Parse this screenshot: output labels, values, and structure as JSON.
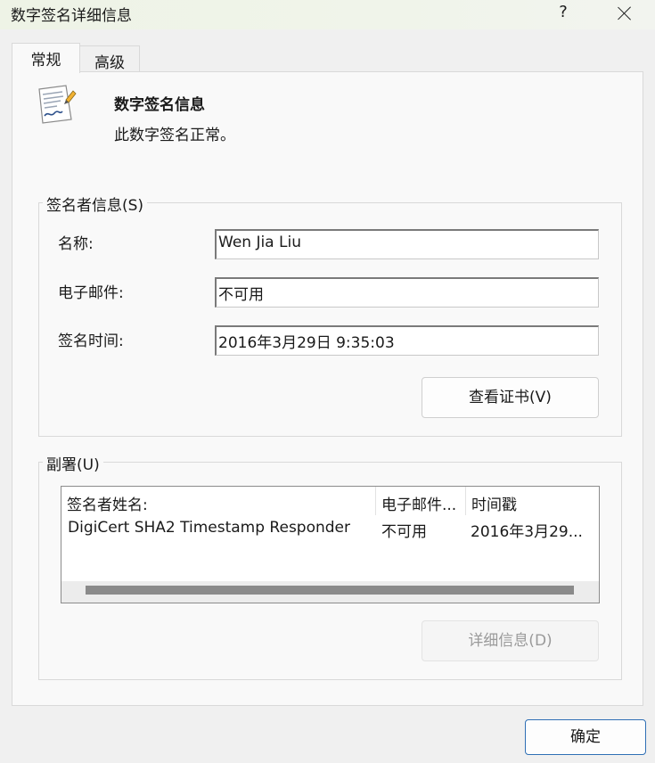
{
  "window": {
    "title": "数字签名详细信息",
    "help_label": "?"
  },
  "tabs": [
    {
      "label": "常规",
      "selected": true
    },
    {
      "label": "高级",
      "selected": false
    }
  ],
  "info": {
    "heading": "数字签名信息",
    "status": "此数字签名正常。"
  },
  "signer": {
    "legend": "签名者信息(S)",
    "name_label": "名称:",
    "name_value": "Wen Jia Liu",
    "email_label": "电子邮件:",
    "email_value": "不可用",
    "time_label": "签名时间:",
    "time_value": "2016年3月29日 9:35:03",
    "view_cert_button": "查看证书(V)"
  },
  "countersignatures": {
    "legend": "副署(U)",
    "columns": [
      "签名者姓名:",
      "电子邮件...",
      "时间戳"
    ],
    "rows": [
      {
        "name": "DigiCert SHA2 Timestamp Responder",
        "email": "不可用",
        "timestamp": "2016年3月29..."
      }
    ],
    "details_button": "详细信息(D)"
  },
  "footer": {
    "ok_button": "确定"
  },
  "colors": {
    "accent": "#2f6fb5",
    "panel_bg": "#f9f9f9",
    "window_bg": "#f0f0f0"
  }
}
